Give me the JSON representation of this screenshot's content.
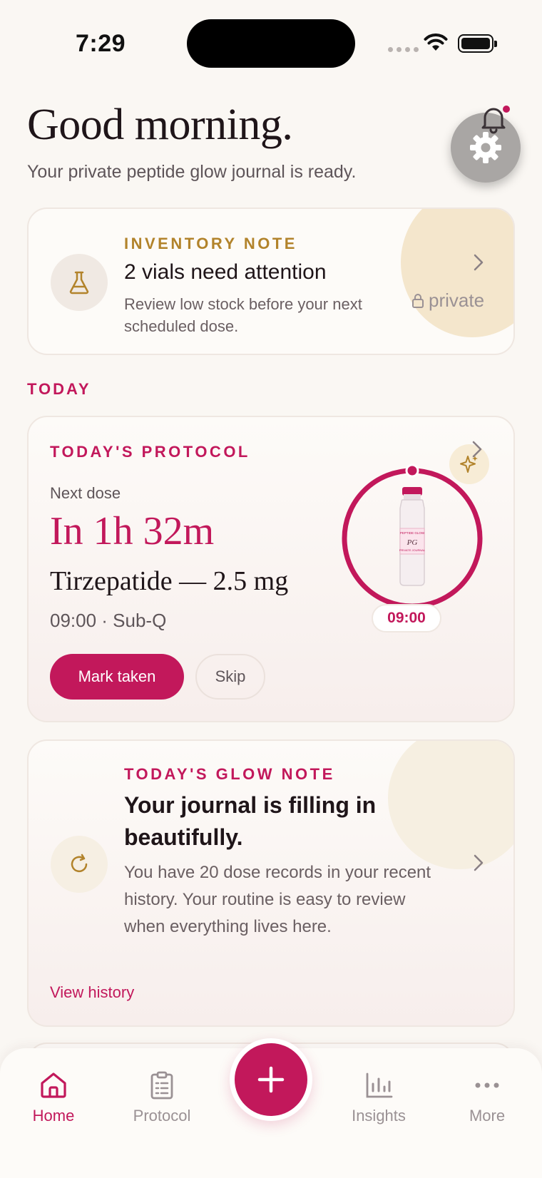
{
  "status_bar": {
    "time": "7:29"
  },
  "header": {
    "greeting": "Good morning.",
    "subtitle": "Your private peptide glow journal is ready."
  },
  "inventory_card": {
    "eyebrow": "INVENTORY NOTE",
    "title": "2 vials need attention",
    "description": "Review low stock before your next scheduled dose.",
    "privacy_label": "private"
  },
  "today_section": {
    "label": "TODAY"
  },
  "protocol_card": {
    "eyebrow": "TODAY'S PROTOCOL",
    "next_label": "Next dose",
    "countdown": "In 1h 32m",
    "drug": "Tirzepatide — 2.5 mg",
    "time_route": "09:00 · Sub-Q",
    "mark_taken_label": "Mark taken",
    "skip_label": "Skip",
    "ring_time": "09:00",
    "vial_label_top": "PEPTIDE GLOW",
    "vial_label_logo": "PG",
    "vial_label_bottom": "PRIVATE JOURNAL"
  },
  "glow_card": {
    "eyebrow": "TODAY'S GLOW NOTE",
    "title": "Your journal is filling in beautifully.",
    "description": "You have 20 dose records in your recent history. Your routine is easy to review when everything lives here.",
    "link": "View history"
  },
  "tab_bar": {
    "items": [
      {
        "label": "Home",
        "icon": "home-icon",
        "active": true
      },
      {
        "label": "Protocol",
        "icon": "clipboard-icon",
        "active": false
      },
      {
        "label": "Insights",
        "icon": "bar-chart-icon",
        "active": false
      },
      {
        "label": "More",
        "icon": "more-dots-icon",
        "active": false
      }
    ],
    "fab_icon": "plus-icon"
  },
  "colors": {
    "accent": "#c2185b",
    "gold": "#b2832b",
    "background": "#faf7f3"
  }
}
